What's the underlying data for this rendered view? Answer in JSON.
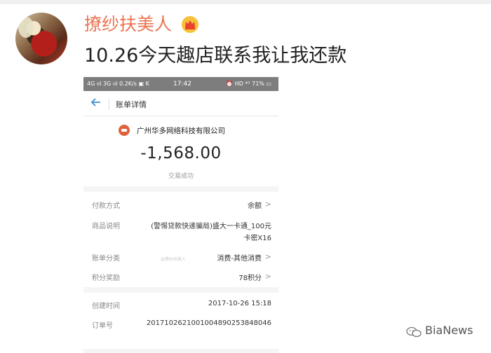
{
  "post": {
    "username": "撩纱扶美人",
    "text": "10.26今天趣店联系我让我还款"
  },
  "phone": {
    "status_left": "4G ııl 3G ııl 0.2K/s ▣ K",
    "time": "17:42",
    "status_right": "⏰ HD ⁴ᴳ 71% ▭",
    "page_title": "账单详情",
    "merchant": "广州华多网络科技有限公司",
    "amount": "-1,568.00",
    "status": "交易成功",
    "rows": [
      {
        "key": "付款方式",
        "value": "余额"
      },
      {
        "key": "商品说明",
        "value": "(警惕贷款快递骗局)盛大一卡通_100元",
        "value2": "卡密X16"
      },
      {
        "key": "账单分类",
        "value": "消费-其他消费"
      },
      {
        "key": "积分奖励",
        "value": "78积分"
      },
      {
        "key": "创建时间",
        "value": "2017-10-26 15:18"
      },
      {
        "key": "订单号",
        "value": "20171026210010048902538480​46"
      }
    ],
    "watermark": "@撩纱扶美人"
  },
  "footer": {
    "brand": "BiaNews"
  },
  "colors": {
    "username": "#eb7350",
    "link_blue": "#3f8ed8",
    "merchant_icon": "#e0603a"
  }
}
